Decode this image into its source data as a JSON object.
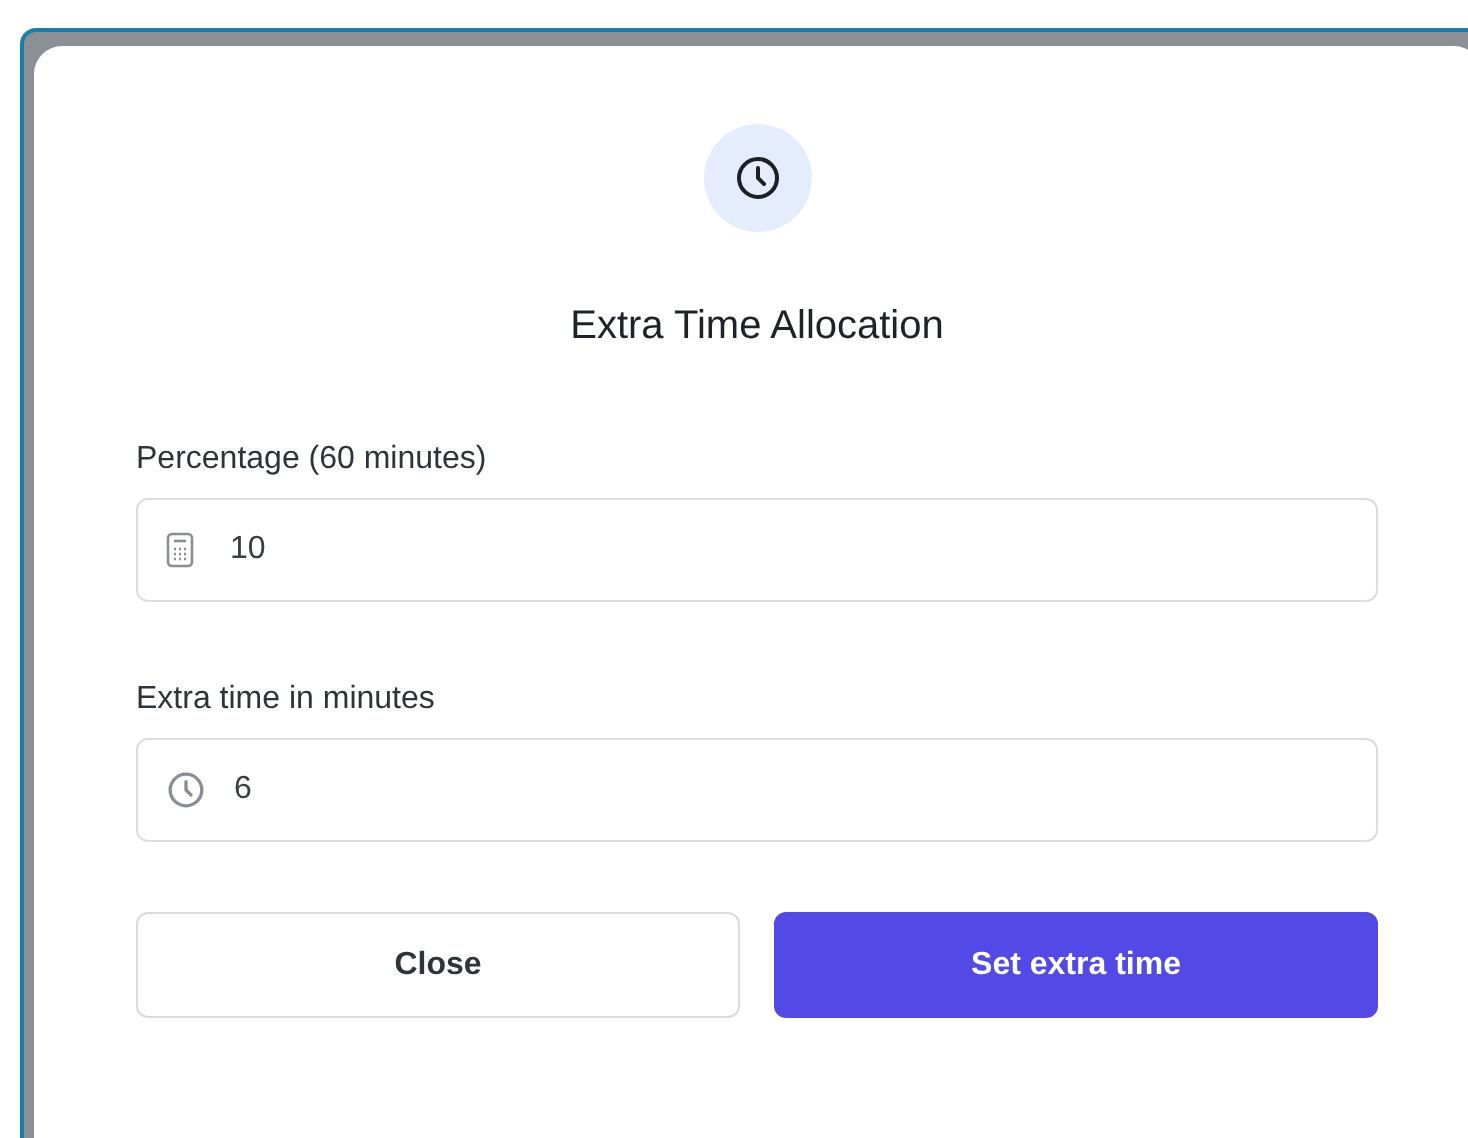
{
  "dialog": {
    "title": "Extra Time Allocation"
  },
  "fields": [
    {
      "kind": "calculator",
      "label": "Percentage (60 minutes)",
      "value": "10"
    },
    {
      "kind": "clock",
      "label": "Extra time in minutes",
      "value": "6"
    }
  ],
  "buttons": [
    {
      "kind": "secondary",
      "label": "Close"
    },
    {
      "kind": "primary",
      "label": "Set extra time"
    }
  ]
}
